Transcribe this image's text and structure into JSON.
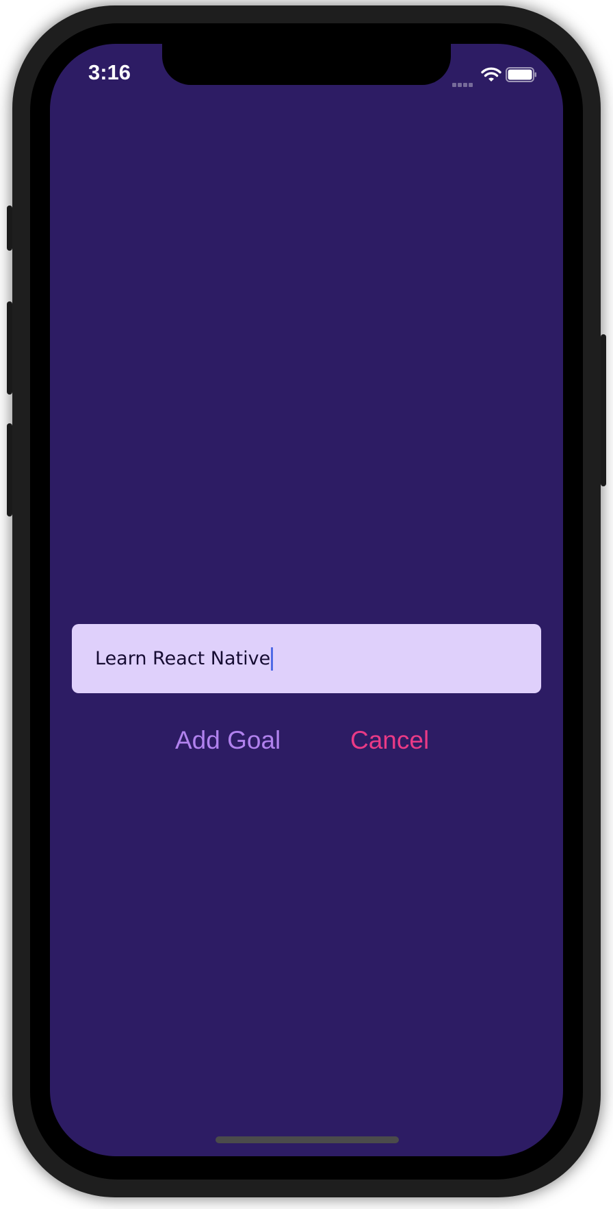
{
  "status_bar": {
    "time": "3:16"
  },
  "goal_input": {
    "value": "Learn React Native"
  },
  "actions": {
    "add_label": "Add Goal",
    "cancel_label": "Cancel"
  },
  "icons": {
    "wifi": "wifi-icon",
    "battery": "battery-icon",
    "signal": "cellular-signal-icon"
  },
  "colors": {
    "background": "#2d1c64",
    "input_background": "#dfd0fb",
    "add_button": "#b182ee",
    "cancel_button": "#ea3a86",
    "caret": "#4f6ae6"
  }
}
